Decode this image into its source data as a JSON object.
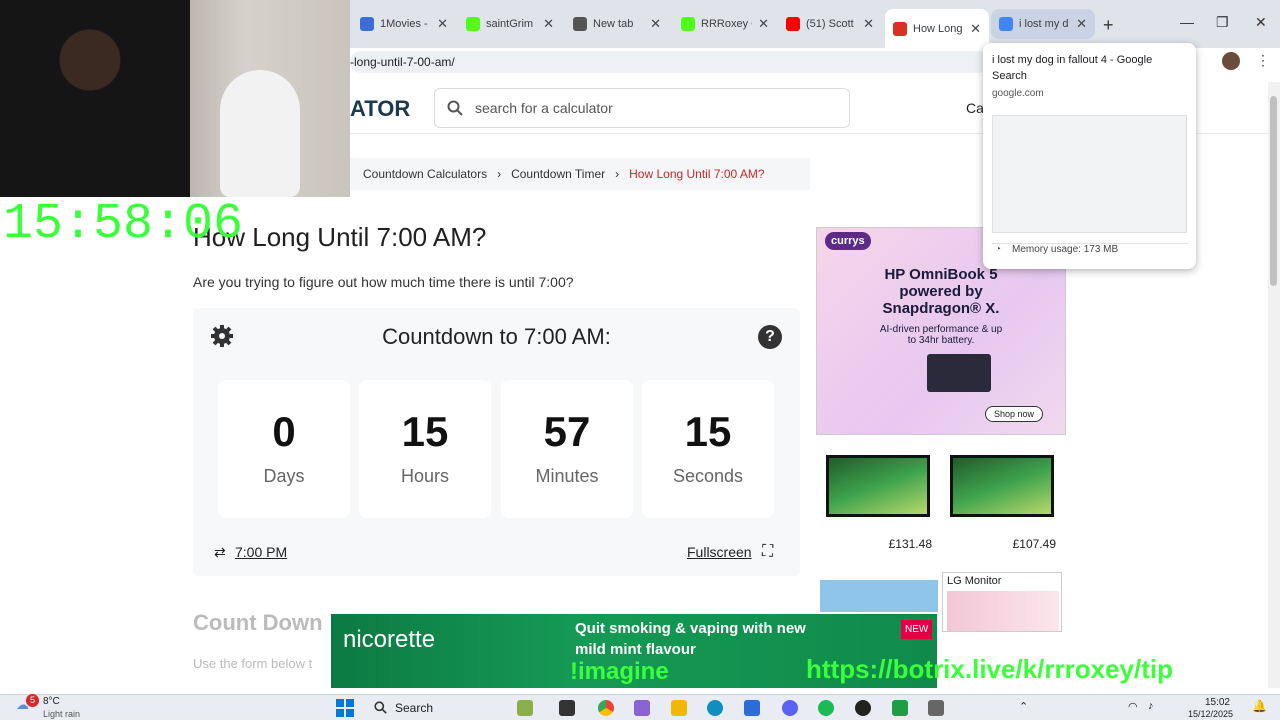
{
  "browser": {
    "tabs": [
      {
        "label": "1Movies -",
        "color": "#3b6fd6"
      },
      {
        "label": "saintGrim",
        "color": "#53fc18"
      },
      {
        "label": "New tab",
        "color": "#555555"
      },
      {
        "label": "RRRoxey C",
        "color": "#53fc18"
      },
      {
        "label": "(51) Scott",
        "color": "#ff0000"
      },
      {
        "label": "How Long",
        "color": "#d93025"
      },
      {
        "label": "i lost my d",
        "color": "#4285f4"
      }
    ],
    "url": "-long-until-7-00-am/"
  },
  "tab_preview": {
    "title": "i lost my dog in fallout 4 - Google Search",
    "domain": "google.com",
    "memory": "Memory usage: 173 MB"
  },
  "site": {
    "logo": "ATOR",
    "search_placeholder": "search for a calculator",
    "nav_partial": "Ca"
  },
  "breadcrumb": [
    "Countdown Calculators",
    "Countdown Timer",
    "How Long Until 7:00 AM?"
  ],
  "page": {
    "title": "How Long Until 7:00 AM?",
    "intro": "Are you trying to figure out how much time there is until 7:00?",
    "countdown_title": "Countdown to 7:00 AM:",
    "units": [
      {
        "value": "0",
        "label": "Days"
      },
      {
        "value": "15",
        "label": "Hours"
      },
      {
        "value": "57",
        "label": "Minutes"
      },
      {
        "value": "15",
        "label": "Seconds"
      }
    ],
    "time_link": "7:00 PM",
    "fullscreen": "Fullscreen",
    "section_title": "Count Down",
    "section_text": "Use the form below t"
  },
  "ads": {
    "currys_brand": "currys",
    "currys_headline": "HP OmniBook 5 powered by Snapdragon® X.",
    "currys_sub": "AI-driven performance & up to 34hr battery.",
    "currys_cta": "Shop now",
    "prices": [
      "£131.48",
      "£107.49"
    ],
    "lg_label": "LG Monitor",
    "nicorette_brand": "nicorette",
    "nicorette_text": "Quit smoking & vaping with new mild mint flavour",
    "nicorette_badge": "NEW"
  },
  "stream_overlay": {
    "clock": "15:58:06",
    "command": "!imagine",
    "url": "https://botrix.live/k/rrroxey/tip"
  },
  "taskbar": {
    "weather_temp": "8°C",
    "weather_desc": "Light rain",
    "search": "Search",
    "time": "15:02",
    "date": "15/12/2025",
    "badge": "5"
  }
}
